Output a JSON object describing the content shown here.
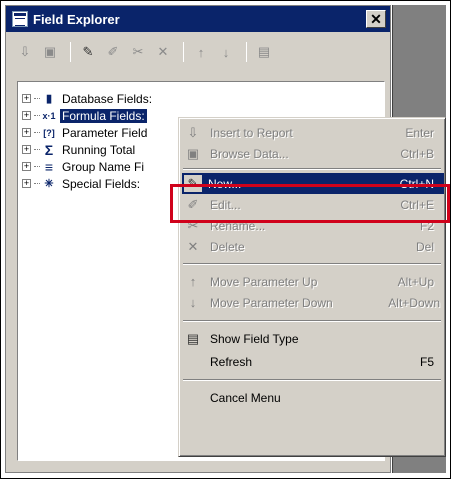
{
  "window": {
    "title": "Field Explorer",
    "close_glyph": "✕"
  },
  "toolbar": {
    "buttons": [
      {
        "icon": "insert-to-report-icon",
        "glyph": "⇩"
      },
      {
        "icon": "browse-data-icon",
        "glyph": "▣"
      },
      {
        "icon": "new-icon",
        "glyph": "✎"
      },
      {
        "icon": "edit-icon",
        "glyph": "✐"
      },
      {
        "icon": "rename-icon",
        "glyph": "✂"
      },
      {
        "icon": "delete-icon",
        "glyph": "✕"
      },
      {
        "icon": "move-up-icon",
        "glyph": "↑"
      },
      {
        "icon": "move-down-icon",
        "glyph": "↓"
      },
      {
        "icon": "show-field-type-icon",
        "glyph": "▤"
      }
    ]
  },
  "tree": {
    "items": [
      {
        "label": "Database Fields:",
        "icon_glyph": "▮",
        "selected": false
      },
      {
        "label": "Formula Fields:",
        "icon_glyph": "x·1",
        "selected": true
      },
      {
        "label": "Parameter Field",
        "icon_glyph": "[?]",
        "selected": false
      },
      {
        "label": "Running Total",
        "icon_glyph": "Σ",
        "selected": false
      },
      {
        "label": "Group Name Fi",
        "icon_glyph": "≡",
        "selected": false
      },
      {
        "label": "Special Fields:",
        "icon_glyph": "✳",
        "selected": false
      }
    ]
  },
  "menu": {
    "insert_to_report": {
      "label": "Insert to Report",
      "shortcut": "Enter"
    },
    "browse_data": {
      "label": "Browse Data...",
      "shortcut": "Ctrl+B"
    },
    "new": {
      "label": "New...",
      "shortcut": "Ctrl+N"
    },
    "edit": {
      "label": "Edit...",
      "shortcut": "Ctrl+E"
    },
    "rename": {
      "label": "Rename...",
      "shortcut": "F2"
    },
    "delete": {
      "label": "Delete",
      "shortcut": "Del"
    },
    "move_param_up": {
      "label": "Move Parameter Up",
      "shortcut": "Alt+Up"
    },
    "move_param_down": {
      "label": "Move Parameter Down",
      "shortcut": "Alt+Down"
    },
    "show_field_type": {
      "label": "Show Field Type",
      "shortcut": ""
    },
    "refresh": {
      "label": "Refresh",
      "shortcut": "F5"
    },
    "cancel_menu": {
      "label": "Cancel Menu",
      "shortcut": ""
    }
  },
  "colors": {
    "title_bar": "#0a246a",
    "highlight": "#0a246a",
    "callout_border": "#d0021b",
    "face": "#d4d0c8"
  }
}
